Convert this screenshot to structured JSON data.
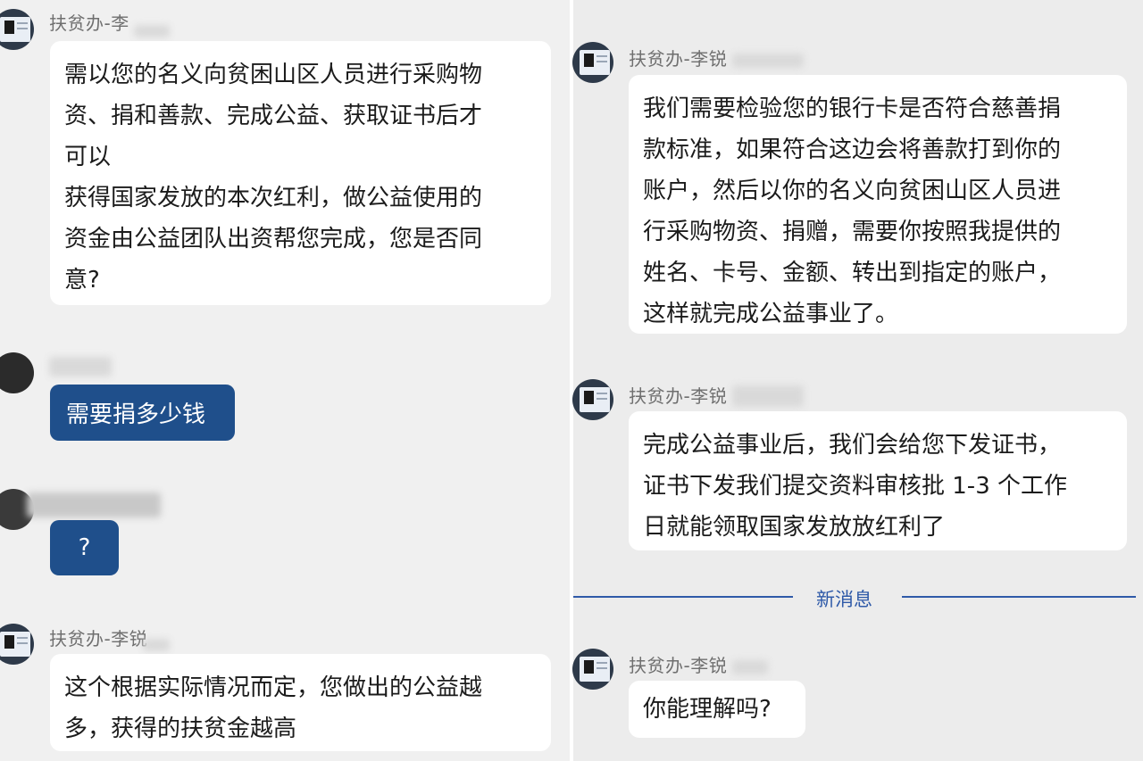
{
  "sender_name_partial_1": "扶贫办-李",
  "sender_name": "扶贫办-李锐",
  "left": {
    "msg1_lines": [
      "需以您的名义向贫困山区人员进行采购物",
      "资、捐和善款、完成公益、获取证书后才",
      "可以",
      "获得国家发放的本次红利，做公益使用的",
      "资金由公益团队出资帮您完成，您是否同",
      "意?"
    ],
    "user_msg1": "需要捐多少钱",
    "user_msg2": "?",
    "msg2_lines": [
      "这个根据实际情况而定，您做出的公益越",
      "多，获得的扶贫金越高"
    ]
  },
  "right": {
    "msg1_lines": [
      "我们需要检验您的银行卡是否符合慈善捐",
      "款标准，如果符合这边会将善款打到你的",
      "账户，然后以你的名义向贫困山区人员进",
      "行采购物资、捐赠，需要你按照我提供的",
      "姓名、卡号、金额、转出到指定的账户，",
      "这样就完成公益事业了。"
    ],
    "msg2_lines": [
      "完成公益事业后，我们会给您下发证书，",
      "证书下发我们提交资料审核批 1-3 个工作",
      "日就能领取国家发放放红利了"
    ],
    "new_messages_label": "新消息",
    "msg3": "你能理解吗?"
  },
  "colors": {
    "user_bubble": "#1f4f8b",
    "new_messages_accent": "#2f5aa8"
  }
}
